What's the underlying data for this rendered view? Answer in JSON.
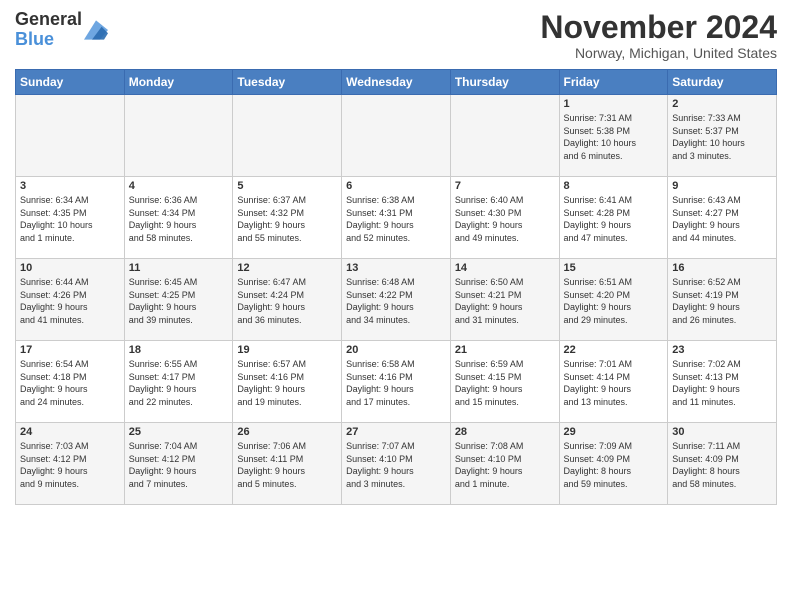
{
  "header": {
    "logo_line1": "General",
    "logo_line2": "Blue",
    "month_title": "November 2024",
    "location": "Norway, Michigan, United States"
  },
  "days_of_week": [
    "Sunday",
    "Monday",
    "Tuesday",
    "Wednesday",
    "Thursday",
    "Friday",
    "Saturday"
  ],
  "weeks": [
    [
      {
        "day": "",
        "info": ""
      },
      {
        "day": "",
        "info": ""
      },
      {
        "day": "",
        "info": ""
      },
      {
        "day": "",
        "info": ""
      },
      {
        "day": "",
        "info": ""
      },
      {
        "day": "1",
        "info": "Sunrise: 7:31 AM\nSunset: 5:38 PM\nDaylight: 10 hours\nand 6 minutes."
      },
      {
        "day": "2",
        "info": "Sunrise: 7:33 AM\nSunset: 5:37 PM\nDaylight: 10 hours\nand 3 minutes."
      }
    ],
    [
      {
        "day": "3",
        "info": "Sunrise: 6:34 AM\nSunset: 4:35 PM\nDaylight: 10 hours\nand 1 minute."
      },
      {
        "day": "4",
        "info": "Sunrise: 6:36 AM\nSunset: 4:34 PM\nDaylight: 9 hours\nand 58 minutes."
      },
      {
        "day": "5",
        "info": "Sunrise: 6:37 AM\nSunset: 4:32 PM\nDaylight: 9 hours\nand 55 minutes."
      },
      {
        "day": "6",
        "info": "Sunrise: 6:38 AM\nSunset: 4:31 PM\nDaylight: 9 hours\nand 52 minutes."
      },
      {
        "day": "7",
        "info": "Sunrise: 6:40 AM\nSunset: 4:30 PM\nDaylight: 9 hours\nand 49 minutes."
      },
      {
        "day": "8",
        "info": "Sunrise: 6:41 AM\nSunset: 4:28 PM\nDaylight: 9 hours\nand 47 minutes."
      },
      {
        "day": "9",
        "info": "Sunrise: 6:43 AM\nSunset: 4:27 PM\nDaylight: 9 hours\nand 44 minutes."
      }
    ],
    [
      {
        "day": "10",
        "info": "Sunrise: 6:44 AM\nSunset: 4:26 PM\nDaylight: 9 hours\nand 41 minutes."
      },
      {
        "day": "11",
        "info": "Sunrise: 6:45 AM\nSunset: 4:25 PM\nDaylight: 9 hours\nand 39 minutes."
      },
      {
        "day": "12",
        "info": "Sunrise: 6:47 AM\nSunset: 4:24 PM\nDaylight: 9 hours\nand 36 minutes."
      },
      {
        "day": "13",
        "info": "Sunrise: 6:48 AM\nSunset: 4:22 PM\nDaylight: 9 hours\nand 34 minutes."
      },
      {
        "day": "14",
        "info": "Sunrise: 6:50 AM\nSunset: 4:21 PM\nDaylight: 9 hours\nand 31 minutes."
      },
      {
        "day": "15",
        "info": "Sunrise: 6:51 AM\nSunset: 4:20 PM\nDaylight: 9 hours\nand 29 minutes."
      },
      {
        "day": "16",
        "info": "Sunrise: 6:52 AM\nSunset: 4:19 PM\nDaylight: 9 hours\nand 26 minutes."
      }
    ],
    [
      {
        "day": "17",
        "info": "Sunrise: 6:54 AM\nSunset: 4:18 PM\nDaylight: 9 hours\nand 24 minutes."
      },
      {
        "day": "18",
        "info": "Sunrise: 6:55 AM\nSunset: 4:17 PM\nDaylight: 9 hours\nand 22 minutes."
      },
      {
        "day": "19",
        "info": "Sunrise: 6:57 AM\nSunset: 4:16 PM\nDaylight: 9 hours\nand 19 minutes."
      },
      {
        "day": "20",
        "info": "Sunrise: 6:58 AM\nSunset: 4:16 PM\nDaylight: 9 hours\nand 17 minutes."
      },
      {
        "day": "21",
        "info": "Sunrise: 6:59 AM\nSunset: 4:15 PM\nDaylight: 9 hours\nand 15 minutes."
      },
      {
        "day": "22",
        "info": "Sunrise: 7:01 AM\nSunset: 4:14 PM\nDaylight: 9 hours\nand 13 minutes."
      },
      {
        "day": "23",
        "info": "Sunrise: 7:02 AM\nSunset: 4:13 PM\nDaylight: 9 hours\nand 11 minutes."
      }
    ],
    [
      {
        "day": "24",
        "info": "Sunrise: 7:03 AM\nSunset: 4:12 PM\nDaylight: 9 hours\nand 9 minutes."
      },
      {
        "day": "25",
        "info": "Sunrise: 7:04 AM\nSunset: 4:12 PM\nDaylight: 9 hours\nand 7 minutes."
      },
      {
        "day": "26",
        "info": "Sunrise: 7:06 AM\nSunset: 4:11 PM\nDaylight: 9 hours\nand 5 minutes."
      },
      {
        "day": "27",
        "info": "Sunrise: 7:07 AM\nSunset: 4:10 PM\nDaylight: 9 hours\nand 3 minutes."
      },
      {
        "day": "28",
        "info": "Sunrise: 7:08 AM\nSunset: 4:10 PM\nDaylight: 9 hours\nand 1 minute."
      },
      {
        "day": "29",
        "info": "Sunrise: 7:09 AM\nSunset: 4:09 PM\nDaylight: 8 hours\nand 59 minutes."
      },
      {
        "day": "30",
        "info": "Sunrise: 7:11 AM\nSunset: 4:09 PM\nDaylight: 8 hours\nand 58 minutes."
      }
    ]
  ]
}
